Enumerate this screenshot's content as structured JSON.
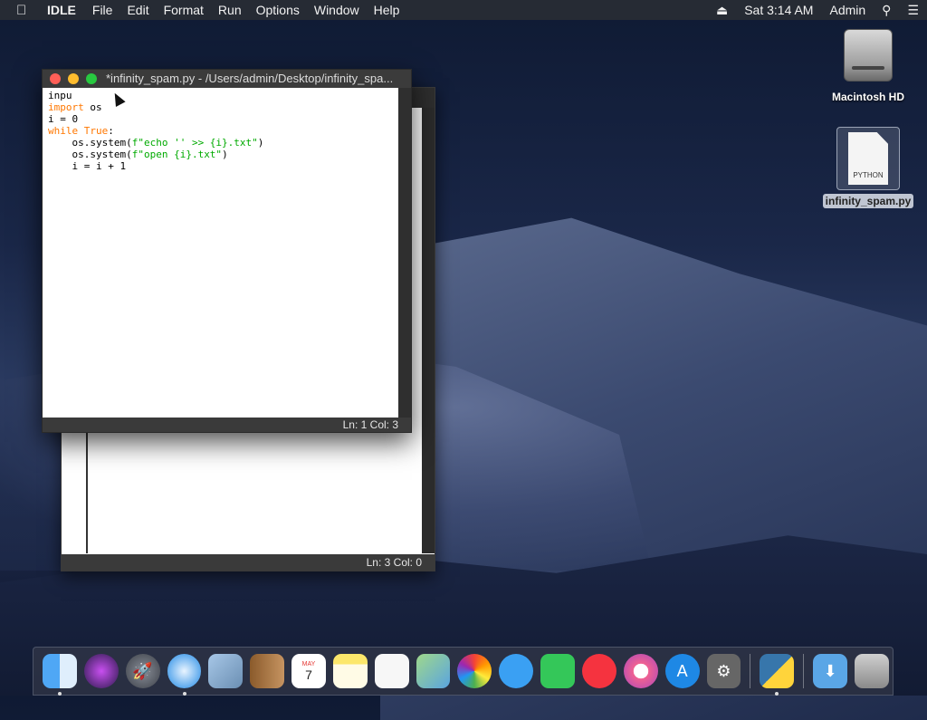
{
  "menubar": {
    "apple_icon": "apple-icon",
    "app_name": "IDLE",
    "menus": [
      "File",
      "Edit",
      "Format",
      "Run",
      "Options",
      "Window",
      "Help"
    ],
    "time": "Sat 3:14 AM",
    "user": "Admin"
  },
  "desktop": {
    "hd_label": "Macintosh HD",
    "file_label": "infinity_spam.py",
    "file_type_badge": "PYTHON"
  },
  "back_window": {
    "status": "Ln: 3  Col: 0"
  },
  "front_window": {
    "title": "*infinity_spam.py - /Users/admin/Desktop/infinity_spa...",
    "status": "Ln: 1  Col: 3",
    "code": {
      "l1": "inpu",
      "l2_kw": "import",
      "l2_rest": " os",
      "l3": "i = 0",
      "l4_kw1": "while",
      "l4_kw2": " True",
      "l4_rest": ":",
      "l5_pre": "    os.system(",
      "l5_str": "f\"echo '' >> {i}.txt\"",
      "l5_post": ")",
      "l6_pre": "    os.system(",
      "l6_str": "f\"open {i}.txt\"",
      "l6_post": ")",
      "l7": "    i = i + 1"
    }
  },
  "dock": {
    "items": [
      "Finder",
      "Siri",
      "Launchpad",
      "Safari",
      "Mail",
      "Contacts",
      "Calendar",
      "Notes",
      "Reminders",
      "Maps",
      "Photos",
      "Messages",
      "FaceTime",
      "News",
      "iTunes",
      "App Store",
      "System Preferences",
      "Python",
      "Downloads",
      "Trash"
    ],
    "calendar_month": "MAY",
    "calendar_day": "7"
  },
  "colors": {
    "keyword": "#ff7700",
    "string": "#00aa00",
    "close": "#ff5f57",
    "minimize": "#febc2e",
    "zoom": "#28c840"
  }
}
